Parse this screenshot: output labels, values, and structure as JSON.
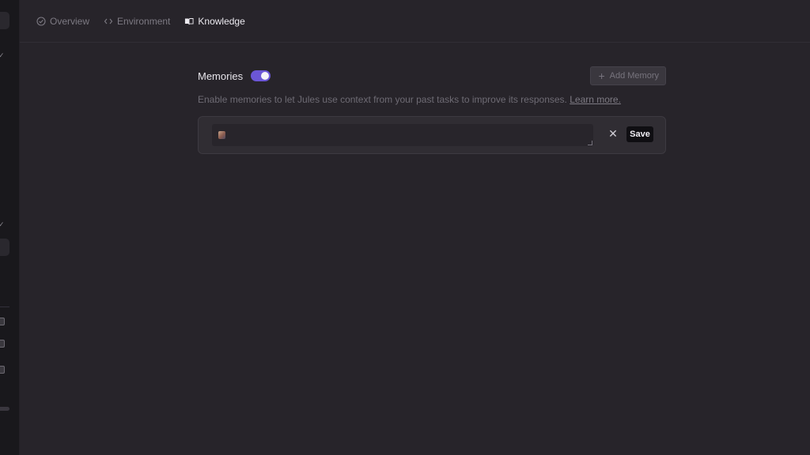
{
  "tabs": [
    {
      "label": "Overview",
      "icon": "check-circle-icon",
      "active": false
    },
    {
      "label": "Environment",
      "icon": "code-icon",
      "active": false
    },
    {
      "label": "Knowledge",
      "icon": "book-icon",
      "active": true
    }
  ],
  "memories": {
    "title": "Memories",
    "enabled": true,
    "add_button_label": "Add Memory",
    "description": "Enable memories to let Jules use context from your past tasks to improve its responses.",
    "link_text": "Learn more.",
    "editor": {
      "value": "",
      "save_label": "Save",
      "close_glyph": "✕"
    }
  },
  "colors": {
    "background": "#27242a",
    "accent": "#6b56d6",
    "sidebar": "#19181c"
  }
}
